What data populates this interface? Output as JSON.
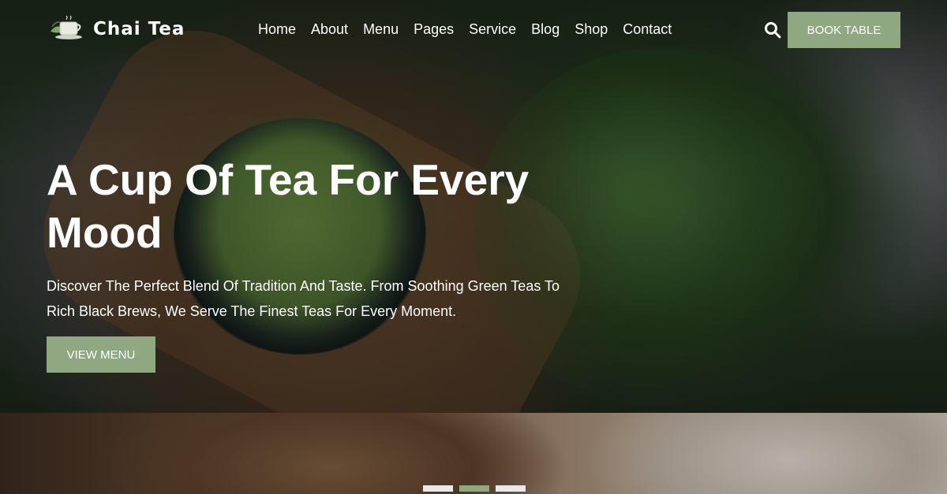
{
  "brand": {
    "name": "Chai Tea",
    "logo_icon": "teacup-leaf-icon"
  },
  "nav": {
    "items": [
      "Home",
      "About",
      "Menu",
      "Pages",
      "Service",
      "Blog",
      "Shop",
      "Contact"
    ],
    "search_icon": "search-icon",
    "book_button": "BOOK TABLE"
  },
  "hero": {
    "title": "A Cup Of Tea For Every Mood",
    "subtitle": "Discover The Perfect Blend Of Tradition And Taste. From Soothing Green Teas To Rich Black Brews, We Serve The Finest Teas For Every Moment.",
    "cta": "VIEW MENU"
  },
  "slider": {
    "count": 3,
    "active_index": 1
  },
  "colors": {
    "accent": "#8fa882",
    "text": "#ffffff",
    "dot_inactive": "#e9e9e9"
  }
}
